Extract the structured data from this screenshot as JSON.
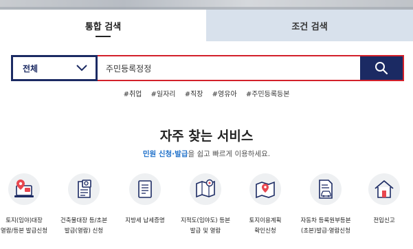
{
  "tabs": {
    "integrated": "통합 검색",
    "conditional": "조건 검색"
  },
  "search": {
    "scope_selected": "전체",
    "query_value": "주민등록정정"
  },
  "hashtags": [
    "#취업",
    "#일자리",
    "#직장",
    "#영유아",
    "#주민등록등본"
  ],
  "section": {
    "title": "자주 찾는 서비스",
    "subtitle_highlight": "민원 신청·발급",
    "subtitle_rest": "을 쉽고 빠르게 이용하세요."
  },
  "services": [
    {
      "label": "토지(임야)대장\n열람/등본 발급신청",
      "icon": "laptop-location-icon"
    },
    {
      "label": "건축물대장 등/초본\n발급(열람) 신청",
      "icon": "building-document-icon"
    },
    {
      "label": "지방세 납세증명",
      "icon": "tax-document-icon"
    },
    {
      "label": "지적도(임야도) 등본\n발급 및 열람",
      "icon": "map-icon"
    },
    {
      "label": "토지이용계획\n확인신청",
      "icon": "land-plan-map-icon"
    },
    {
      "label": "자동차 등록원부등본\n(초본)발급·열람신청",
      "icon": "car-registration-icon"
    },
    {
      "label": "전입신고",
      "icon": "house-move-in-icon"
    }
  ],
  "colors": {
    "navy": "#1b2a63",
    "red_border": "#d3202a",
    "highlight_blue": "#1d6fc9",
    "icon_red": "#e8474f",
    "tab_inactive_bg": "#d8e1ec"
  }
}
